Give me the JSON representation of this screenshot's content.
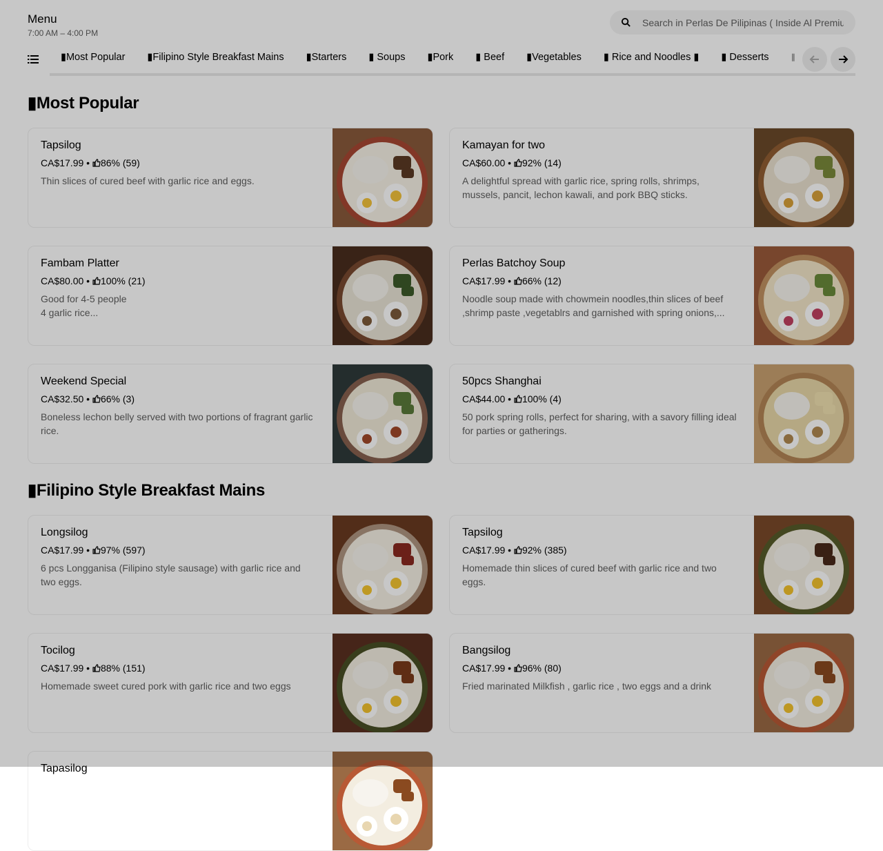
{
  "header": {
    "title": "Menu",
    "hours": "7:00 AM – 4:00 PM",
    "search_placeholder": "Search in Perlas De Pilipinas ( Inside Al Premium Food Mart )"
  },
  "tabs": [
    "▮Most Popular",
    "▮Filipino Style Breakfast Mains",
    "▮Starters",
    "▮ Soups",
    "▮Pork",
    "▮ Beef",
    "▮Vegetables",
    "▮ Rice and Noodles ▮",
    "▮ Desserts",
    "▮"
  ],
  "active_tab": 0,
  "sections": [
    {
      "title": "▮Most Popular",
      "items": [
        {
          "name": "Tapsilog",
          "price": "CA$17.99",
          "rating": "86% (59)",
          "desc": "Thin slices of cured beef with garlic rice and eggs."
        },
        {
          "name": "Kamayan for two",
          "price": "CA$60.00",
          "rating": "92% (14)",
          "desc": "A delightful spread with garlic rice, spring rolls, shrimps, mussels, pancit, lechon kawali, and pork BBQ sticks."
        },
        {
          "name": "Fambam Platter",
          "price": "CA$80.00",
          "rating": "100% (21)",
          "desc": "Good for 4-5 people\n4 garlic rice..."
        },
        {
          "name": "Perlas Batchoy Soup",
          "price": "CA$17.99",
          "rating": "66% (12)",
          "desc": "Noodle soup made with chowmein noodles,thin slices of beef ,shrimp paste ,vegetablrs and garnished with spring onions,..."
        },
        {
          "name": "Weekend Special",
          "price": "CA$32.50",
          "rating": "66% (3)",
          "desc": "Boneless lechon belly served with two portions of fragrant garlic rice."
        },
        {
          "name": "50pcs Shanghai",
          "price": "CA$44.00",
          "rating": "100% (4)",
          "desc": "50 pork spring rolls, perfect for sharing, with a savory filling ideal for parties or gatherings."
        }
      ]
    },
    {
      "title": "▮Filipino Style Breakfast Mains",
      "items": [
        {
          "name": "Longsilog",
          "price": "CA$17.99",
          "rating": "97% (597)",
          "desc": "6 pcs Longganisa (Filipino style sausage) with garlic rice and two eggs."
        },
        {
          "name": "Tapsilog",
          "price": "CA$17.99",
          "rating": "92% (385)",
          "desc": "Homemade thin slices of cured beef with garlic rice and two eggs."
        },
        {
          "name": "Tocilog",
          "price": "CA$17.99",
          "rating": "88% (151)",
          "desc": "Homemade sweet cured pork with garlic rice and two eggs"
        },
        {
          "name": "Bangsilog",
          "price": "CA$17.99",
          "rating": "96% (80)",
          "desc": "Fried marinated Milkfish , garlic rice , two eggs and a drink"
        },
        {
          "name": "Tapasilog",
          "price": "",
          "rating": "",
          "desc": ""
        }
      ]
    }
  ],
  "colors": {
    "accent": "#000000",
    "muted": "#5e5e5e",
    "card_border": "#eeeeee"
  }
}
